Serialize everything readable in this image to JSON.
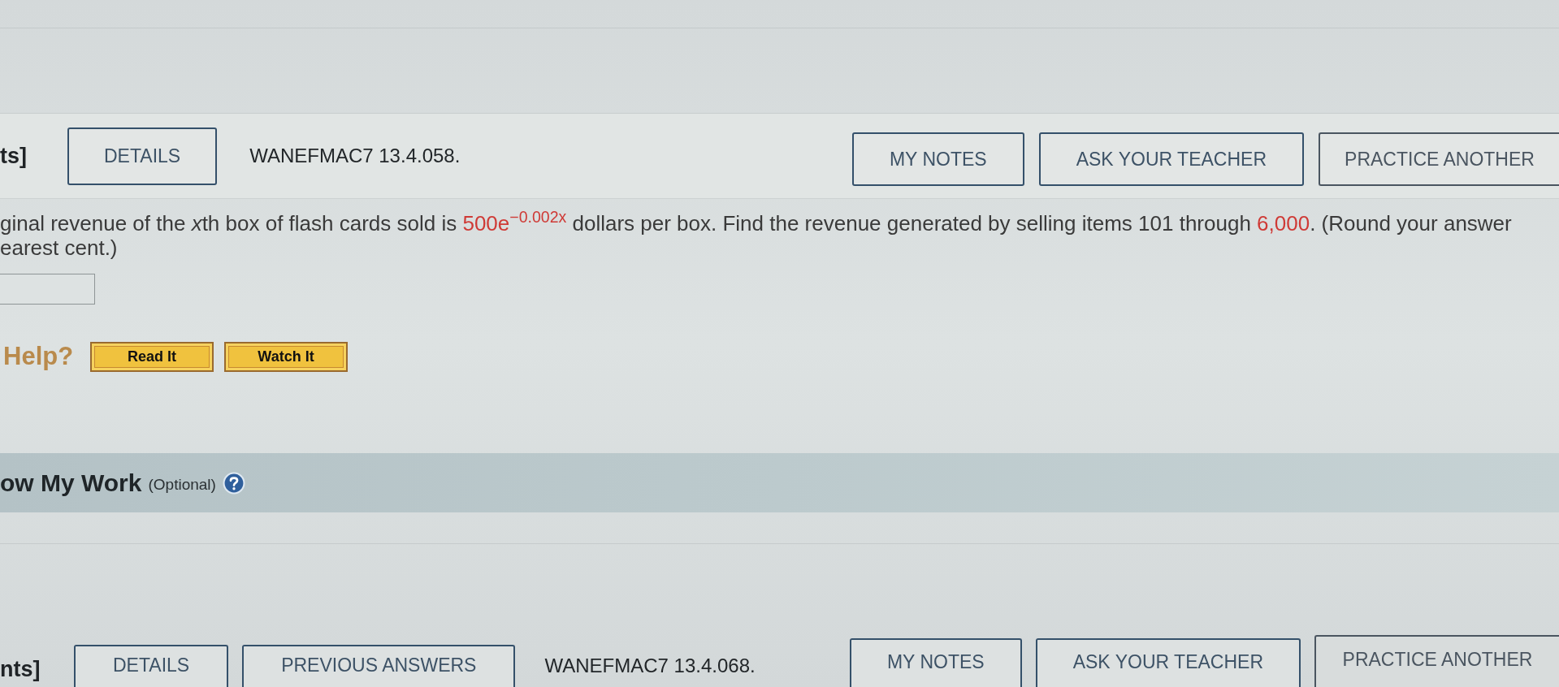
{
  "question_1": {
    "points": "ts]",
    "left_buttons": [
      "DETAILS"
    ],
    "code": "WANEFMAC7 13.4.058.",
    "right_buttons": [
      "MY NOTES",
      "ASK YOUR TEACHER",
      "PRACTICE ANOTHER"
    ]
  },
  "prompt_lines": [
    [
      {
        "kind": "plain",
        "text": "ginal revenue of the "
      },
      {
        "kind": "variable",
        "text": "x"
      },
      {
        "kind": "plain",
        "text": "th box of flash cards sold is "
      },
      {
        "kind": "given",
        "text": "500e$^{−0.002x}$"
      },
      {
        "kind": "plain",
        "text": " dollars per box. Find the revenue generated by selling items 101 through "
      },
      {
        "kind": "given",
        "text": "6,000"
      },
      {
        "kind": "plain",
        "text": ". (Round your answer"
      }
    ],
    [
      {
        "kind": "plain",
        "text": "earest cent.)"
      }
    ]
  ],
  "help": {
    "label": "Help?",
    "buttons": [
      "Read It",
      "Watch It"
    ]
  },
  "show_my_work": {
    "title": "ow My Work",
    "note": "(Optional)"
  },
  "question_2": {
    "points": "nts]",
    "left_buttons": [
      "DETAILS",
      "PREVIOUS ANSWERS"
    ],
    "code": "WANEFMAC7 13.4.068.",
    "right_buttons": [
      "MY NOTES",
      "ASK YOUR TEACHER",
      "PRACTICE ANOTHER"
    ]
  }
}
